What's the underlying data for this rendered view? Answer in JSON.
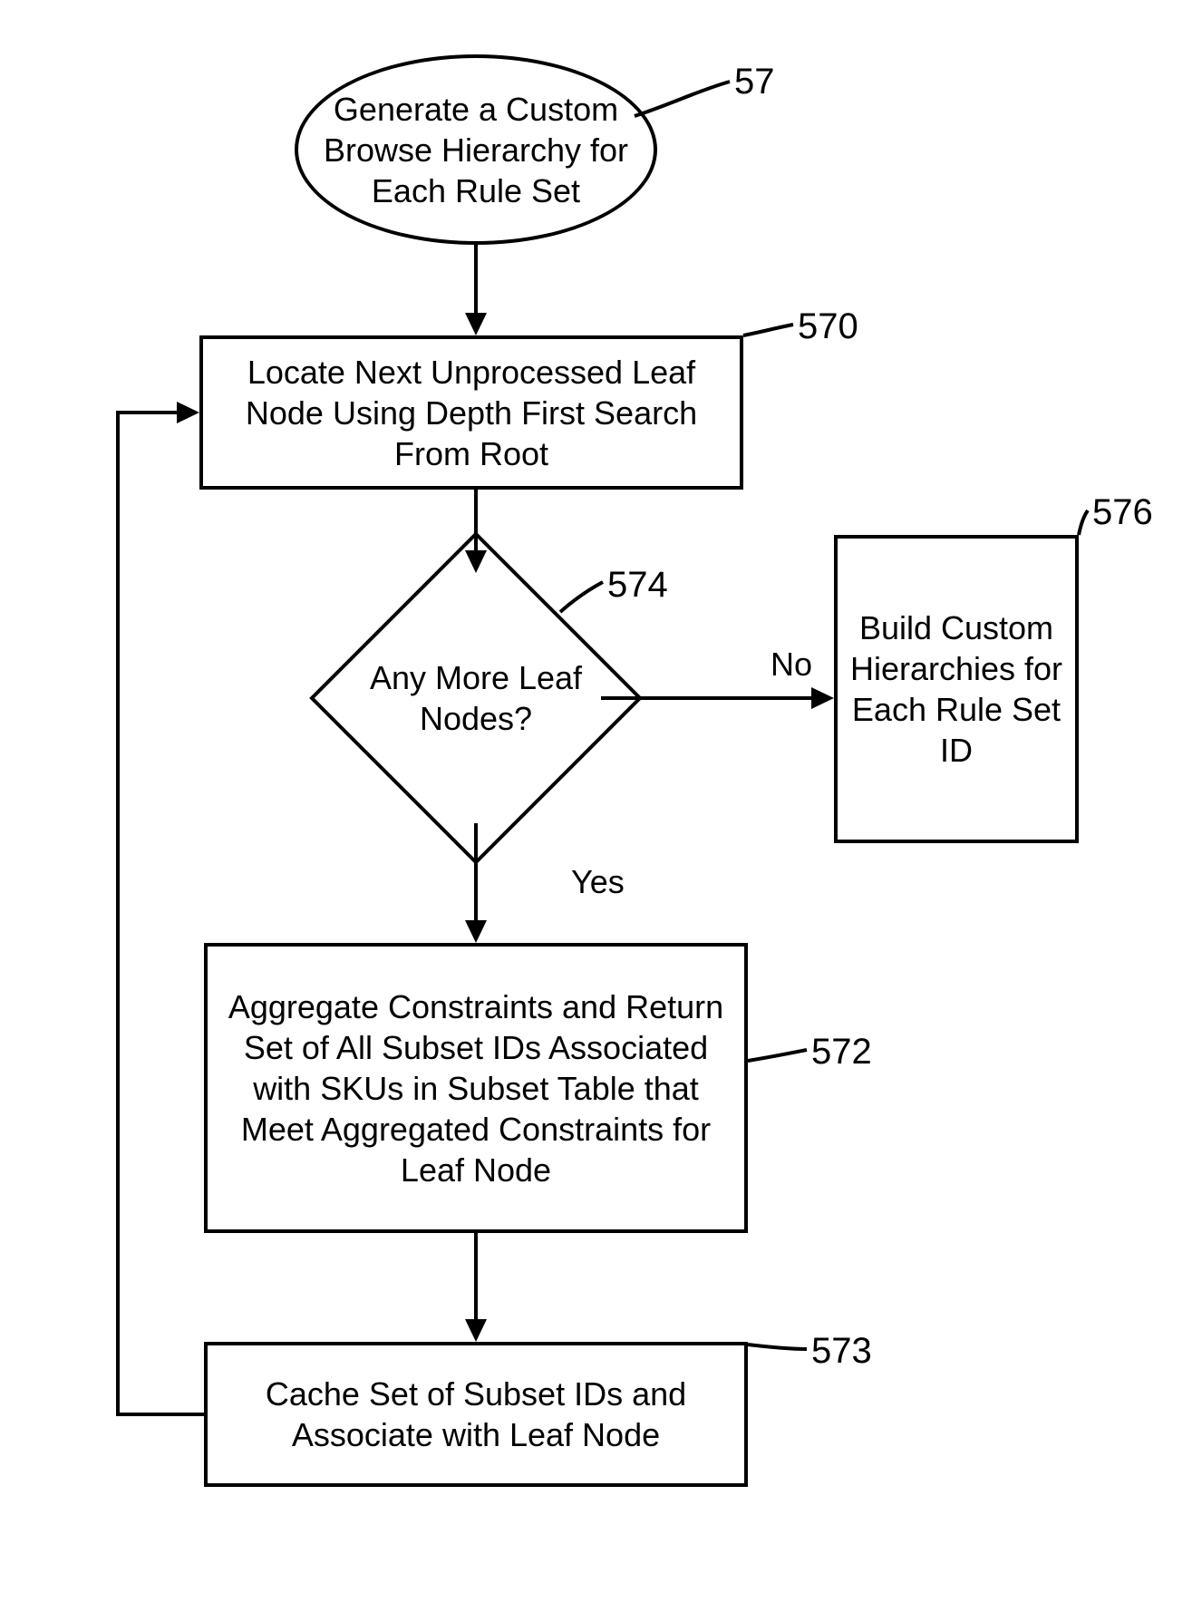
{
  "nodes": {
    "start": {
      "ref": "57",
      "text": "Generate a Custom Browse Hierarchy for Each Rule Set"
    },
    "locate": {
      "ref": "570",
      "text": "Locate Next Unprocessed Leaf Node Using Depth First Search From Root"
    },
    "any": {
      "ref": "574",
      "text": "Any More Leaf Nodes?"
    },
    "build": {
      "ref": "576",
      "text": "Build Custom Hierarchies for Each Rule Set ID"
    },
    "agg": {
      "ref": "572",
      "text": "Aggregate Constraints and Return Set of All Subset IDs Associated with SKUs in Subset Table that Meet Aggregated Constraints for Leaf Node"
    },
    "cache": {
      "ref": "573",
      "text": "Cache Set of Subset IDs and Associate with Leaf Node"
    }
  },
  "edges": {
    "yes": "Yes",
    "no": "No"
  }
}
